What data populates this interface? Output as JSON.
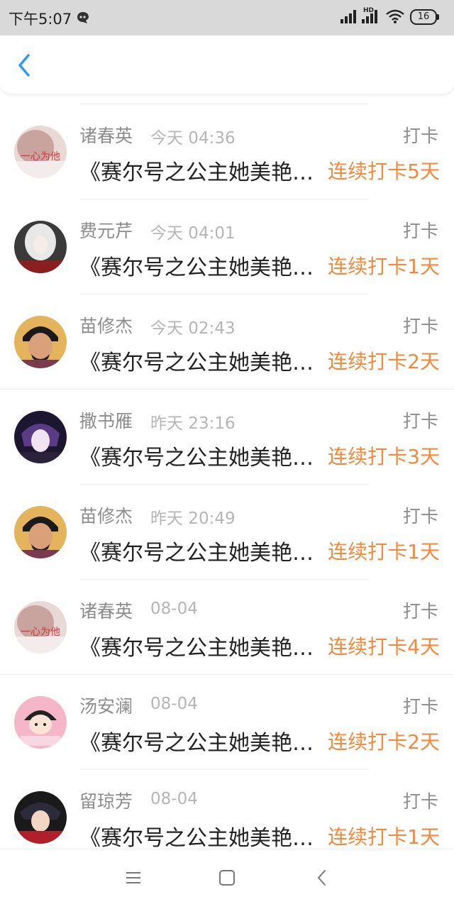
{
  "status_bar": {
    "time": "下午5:07",
    "hd_label": "HD",
    "battery": "16",
    "notification_icon": "bubble-notification-icon",
    "signal_icon": "cellular-signal-icon",
    "wifi_icon": "wifi-icon"
  },
  "header": {
    "back_icon": "chevron-left-icon",
    "accent_color": "#2d9bf0"
  },
  "colors": {
    "streak": "#f5883b",
    "meta_text": "#8c8c8c",
    "time_text": "#b5b5b5"
  },
  "feed": {
    "items": [
      {
        "name": "诸春英",
        "time": "今天 04:36",
        "tag": "打卡",
        "title": "《赛尔号之公主她美艳…",
        "streak": "连续打卡5天",
        "avatar_text": "一心为他"
      },
      {
        "name": "费元芹",
        "time": "今天 04:01",
        "tag": "打卡",
        "title": "《赛尔号之公主她美艳…",
        "streak": "连续打卡1天",
        "avatar_text": ""
      },
      {
        "name": "苗修杰",
        "time": "今天 02:43",
        "tag": "打卡",
        "title": "《赛尔号之公主她美艳…",
        "streak": "连续打卡2天",
        "avatar_text": ""
      },
      {
        "name": "撒书雁",
        "time": "昨天 23:16",
        "tag": "打卡",
        "title": "《赛尔号之公主她美艳…",
        "streak": "连续打卡3天",
        "avatar_text": ""
      },
      {
        "name": "苗修杰",
        "time": "昨天 20:49",
        "tag": "打卡",
        "title": "《赛尔号之公主她美艳…",
        "streak": "连续打卡1天",
        "avatar_text": ""
      },
      {
        "name": "诸春英",
        "time": "08-04",
        "tag": "打卡",
        "title": "《赛尔号之公主她美艳…",
        "streak": "连续打卡4天",
        "avatar_text": "一心为他"
      },
      {
        "name": "汤安澜",
        "time": "08-04",
        "tag": "打卡",
        "title": "《赛尔号之公主她美艳…",
        "streak": "连续打卡2天",
        "avatar_text": ""
      },
      {
        "name": "留琼芳",
        "time": "08-04",
        "tag": "打卡",
        "title": "《赛尔号之公主她美艳…",
        "streak": "连续打卡1天",
        "avatar_text": ""
      }
    ]
  },
  "nav_bar": {
    "menu_icon": "menu-icon",
    "home_icon": "home-square-icon",
    "back_icon": "nav-back-icon"
  }
}
